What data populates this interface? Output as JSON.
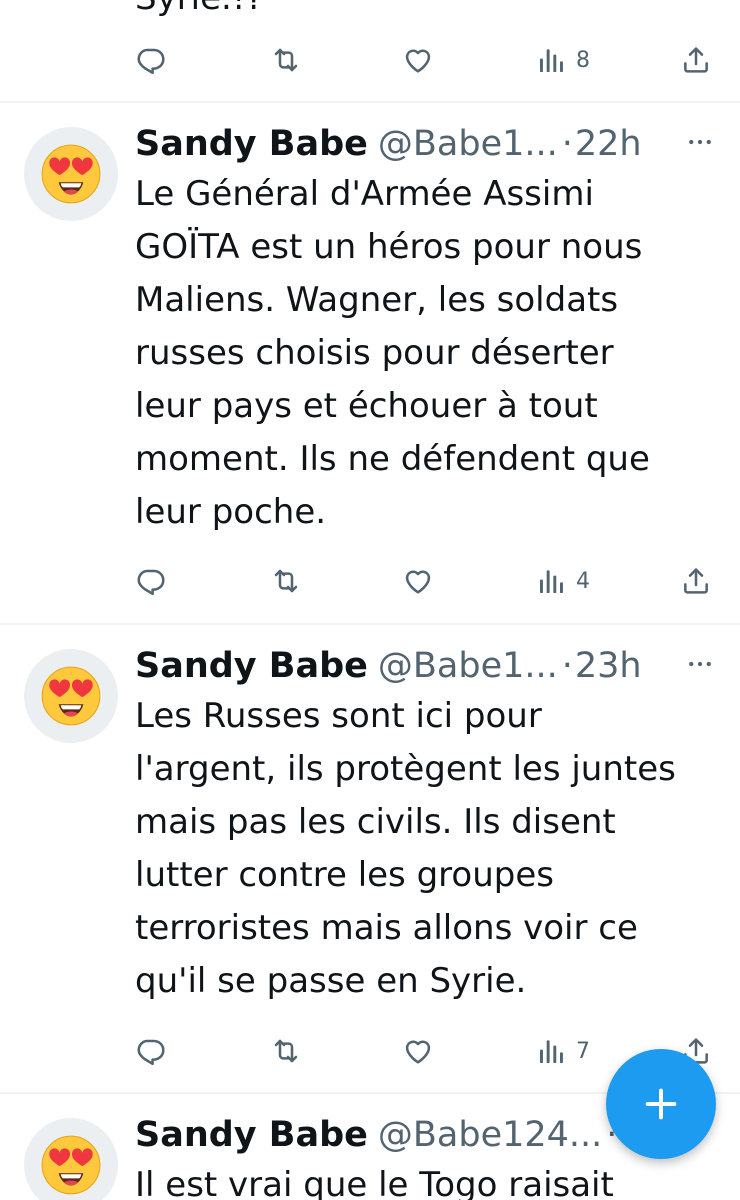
{
  "top_partial": {
    "text_fragment": "Syrie.!?",
    "views": "8"
  },
  "tweets": [
    {
      "name": "Sandy Babe",
      "handle": "@Babe1...",
      "separator": "·",
      "time": "22h",
      "text": "Le Général d'Armée Assimi\nGOÏTA est un héros pour nous\nMaliens. Wagner, les soldats\nrusses choisis pour déserter\nleur pays et échouer à tout\nmoment. Ils ne défendent que\nleur poche.",
      "views": "4",
      "avatar_icon": "heart-eyes-emoji-icon"
    },
    {
      "name": "Sandy Babe",
      "handle": "@Babe1...",
      "separator": "·",
      "time": "23h",
      "text": "Les Russes sont ici pour\nl'argent, ils protègent les juntes\nmais pas les civils. Ils disent\nlutter contre les groupes\nterroristes mais allons voir ce\nqu'il se passe en Syrie.",
      "views": "7",
      "avatar_icon": "heart-eyes-emoji-icon"
    },
    {
      "name": "Sandy Babe",
      "handle": "@Babe124...",
      "separator": "·",
      "text_fragment": "Il est vrai que le Togo raisait",
      "avatar_icon": "heart-eyes-emoji-icon"
    }
  ],
  "fab_label": "+",
  "colors": {
    "text": "#0f1419",
    "secondary": "#536471",
    "divider": "#eff3f4",
    "accent": "#1d9bf0",
    "avatar_bg": "#eceff1"
  }
}
